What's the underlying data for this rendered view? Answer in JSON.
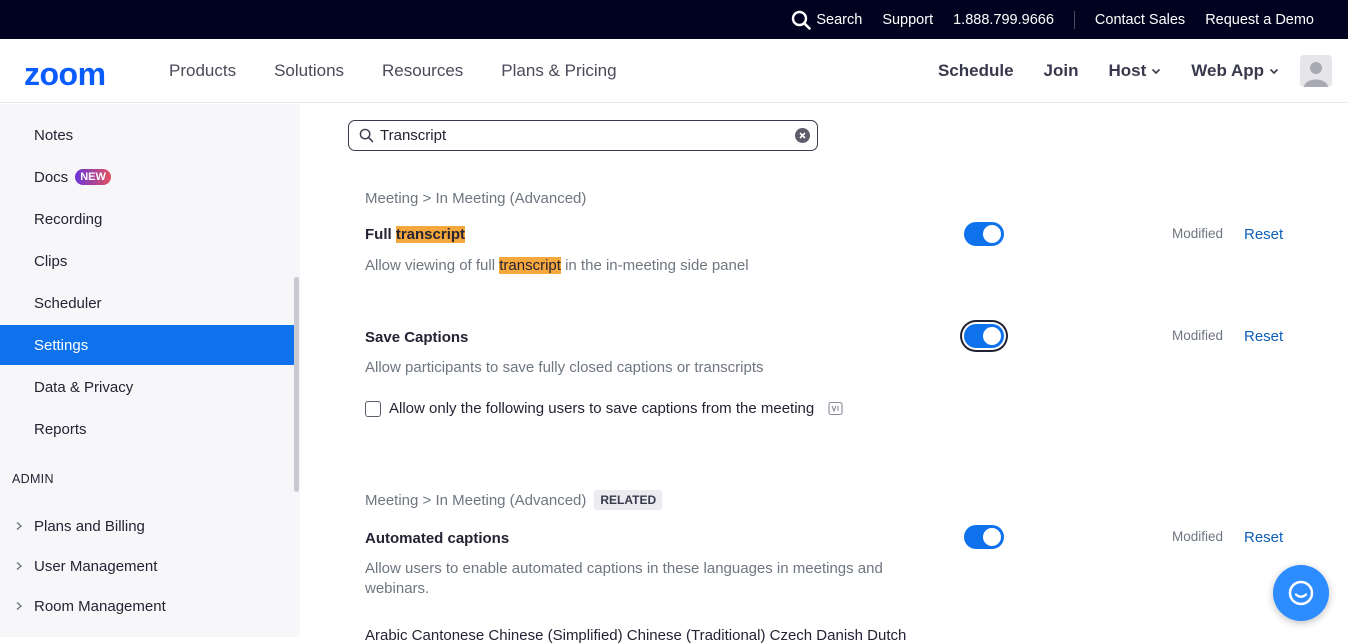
{
  "topbar": {
    "search": "Search",
    "support": "Support",
    "phone": "1.888.799.9666",
    "contact_sales": "Contact Sales",
    "request_demo": "Request a Demo"
  },
  "nav": {
    "logo": "zoom",
    "left": [
      "Products",
      "Solutions",
      "Resources",
      "Plans & Pricing"
    ],
    "schedule": "Schedule",
    "join": "Join",
    "host": "Host",
    "web_app": "Web App"
  },
  "sidebar": {
    "items": [
      "Notes",
      "Docs",
      "Recording",
      "Clips",
      "Scheduler",
      "Settings",
      "Data & Privacy",
      "Reports"
    ],
    "new_badge": "NEW",
    "active": "Settings",
    "admin_header": "ADMIN",
    "admin_items": [
      "Plans and Billing",
      "User Management",
      "Room Management"
    ]
  },
  "search": {
    "value": "Transcript"
  },
  "settings": {
    "s1": {
      "crumb": "Meeting > In Meeting (Advanced)",
      "title_pre": "Full ",
      "title_hl": "transcript",
      "desc_pre": "Allow viewing of full ",
      "desc_hl": "transcript",
      "desc_post": " in the in-meeting side panel",
      "modified": "Modified",
      "reset": "Reset",
      "enabled": true
    },
    "s2": {
      "title": "Save Captions",
      "desc": "Allow participants to save fully closed captions or transcripts",
      "checkbox_label": "Allow only the following users to save captions from the meeting",
      "modified": "Modified",
      "reset": "Reset",
      "enabled": true
    },
    "s3": {
      "crumb": "Meeting > In Meeting (Advanced)",
      "related": "RELATED",
      "title": "Automated captions",
      "desc": "Allow users to enable automated captions in these languages in meetings and webinars.",
      "modified": "Modified",
      "reset": "Reset",
      "enabled": true,
      "languages": "Arabic   Cantonese   Chinese (Simplified)   Chinese (Traditional)   Czech   Danish   Dutch"
    }
  },
  "colors": {
    "accent": "#0e72ed",
    "highlight": "#f7a83c",
    "topbar": "#00031f",
    "logo": "#0b5cff"
  }
}
